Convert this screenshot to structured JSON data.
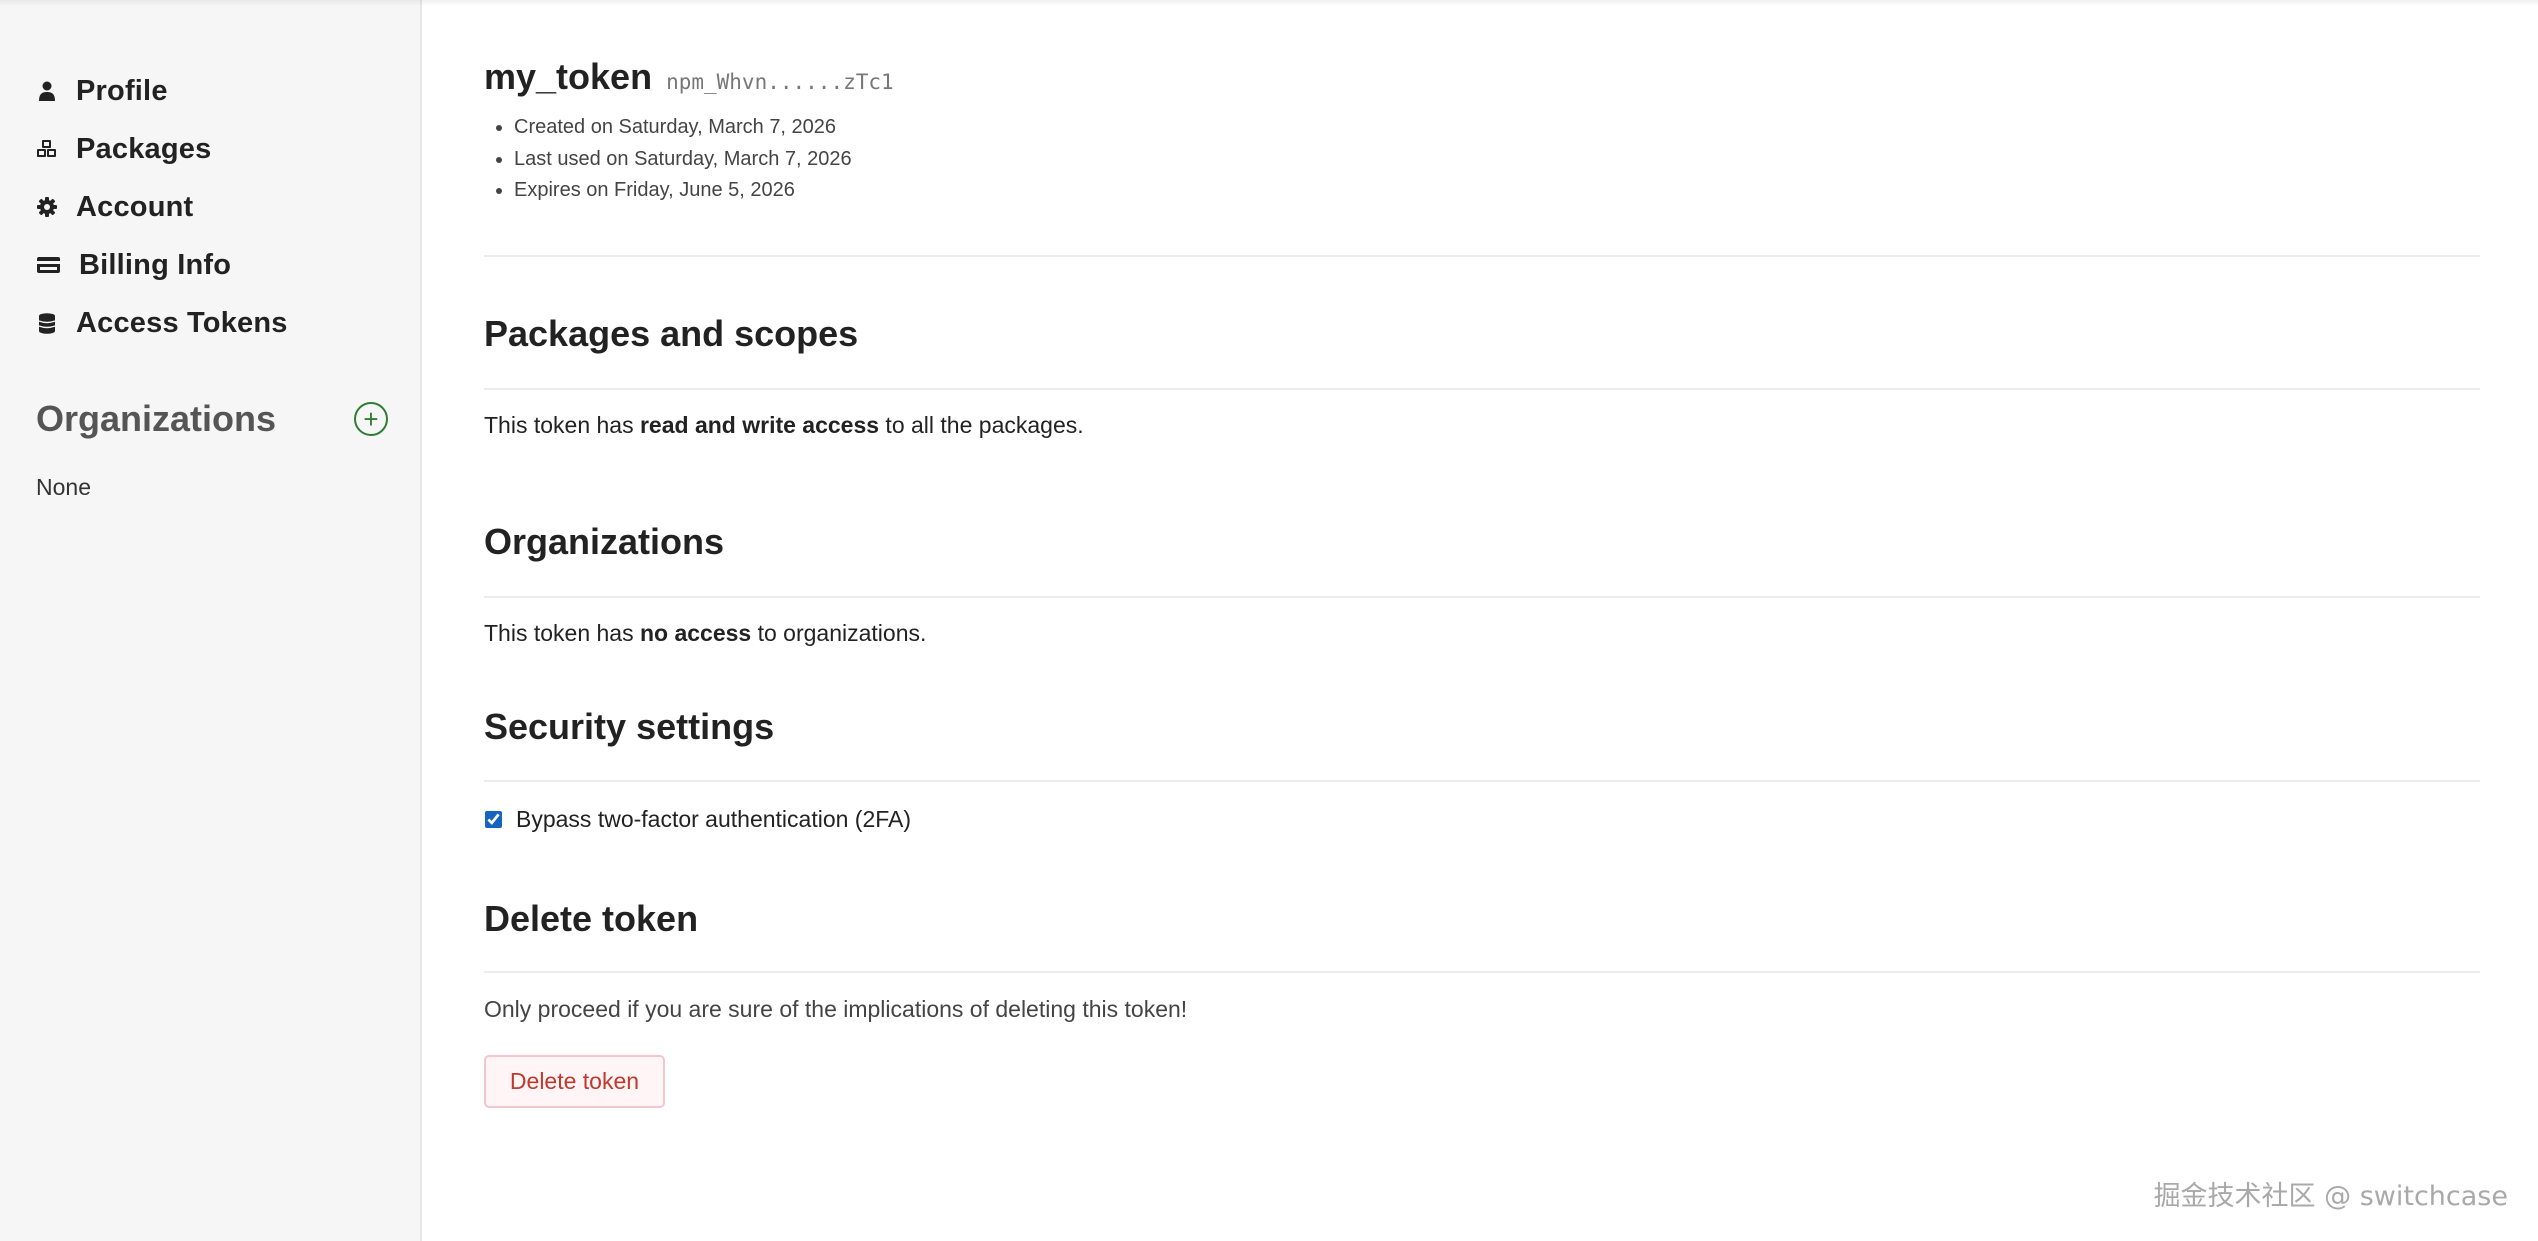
{
  "sidebar": {
    "items": [
      {
        "label": "Profile",
        "icon": "user-icon"
      },
      {
        "label": "Packages",
        "icon": "packages-icon"
      },
      {
        "label": "Account",
        "icon": "gear-icon"
      },
      {
        "label": "Billing Info",
        "icon": "credit-card-icon"
      },
      {
        "label": "Access Tokens",
        "icon": "coins-icon"
      }
    ],
    "organizations_title": "Organizations",
    "add_org_symbol": "+",
    "organizations_value": "None"
  },
  "token": {
    "name": "my_token",
    "masked_value": "npm_Whvn......zTc1",
    "created": "Created on Saturday, March 7, 2026",
    "last_used": "Last used on Saturday, March 7, 2026",
    "expires": "Expires on Friday, June 5, 2026"
  },
  "packages_scopes": {
    "title": "Packages and scopes",
    "text_prefix": "This token has ",
    "text_bold": "read and write access",
    "text_suffix": " to all the packages."
  },
  "organizations": {
    "title": "Organizations",
    "text_prefix": "This token has ",
    "text_bold": "no access",
    "text_suffix": " to organizations."
  },
  "security": {
    "title": "Security settings",
    "bypass_2fa_label": "Bypass two-factor authentication (2FA)",
    "bypass_2fa_checked": true
  },
  "delete": {
    "title": "Delete token",
    "warning": "Only proceed if you are sure of the implications of deleting this token!",
    "button_label": "Delete token"
  },
  "watermark": "掘金技术社区 @ switchcase",
  "colors": {
    "sidebar_bg": "#f6f6f6",
    "add_org_green": "#2e7d32",
    "delete_red": "#c0392b",
    "checkbox_blue": "#1565c0"
  }
}
